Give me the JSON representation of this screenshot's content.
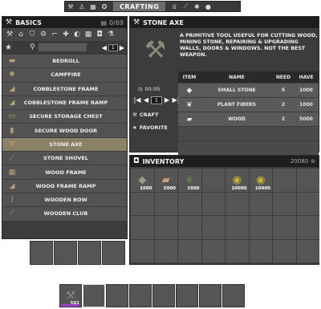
{
  "topbar": {
    "active_tab": "CRAFTING",
    "left_icons": [
      "hammer-icon",
      "person-icon",
      "map-icon",
      "skill-icon"
    ],
    "right_icons": [
      "trophy-icon",
      "sword-icon",
      "creatures-icon",
      "bulb-icon"
    ]
  },
  "basics": {
    "title": "BASICS",
    "count": "0/69",
    "categories": [
      "hammer-icon",
      "home-icon",
      "shield-icon",
      "wrench-icon",
      "gun-icon",
      "medkit-icon",
      "food-icon",
      "grid-icon"
    ],
    "search_placeholder": "",
    "page": "1",
    "recipes": [
      {
        "label": "BEDROLL",
        "icon": "▬"
      },
      {
        "label": "CAMPFIRE",
        "icon": "✺"
      },
      {
        "label": "COBBLESTONE FRAME",
        "icon": "◢"
      },
      {
        "label": "COBBLESTONE FRAME RAMP",
        "icon": "◢"
      },
      {
        "label": "SECURE STORAGE CHEST",
        "icon": "▭"
      },
      {
        "label": "SECURE WOOD DOOR",
        "icon": "▮"
      },
      {
        "label": "STONE AXE",
        "icon": "⚒",
        "selected": true
      },
      {
        "label": "STONE SHOVEL",
        "icon": "⟋"
      },
      {
        "label": "WOOD FRAME",
        "icon": "▦"
      },
      {
        "label": "WOOD FRAME RAMP",
        "icon": "◢"
      },
      {
        "label": "WOODEN BOW",
        "icon": ")"
      },
      {
        "label": "WOODEN CLUB",
        "icon": "⟋"
      }
    ]
  },
  "detail": {
    "title": "STONE AXE",
    "description": "A PRIMITIVE TOOL USEFUL FOR CUTTING WOOD, MINING STONE, REPAIRING & UPGRADING WALLS, DOORS & WINDOWS. NOT THE BEST WEAPON.",
    "craft_time": "00:05",
    "quantity": "1",
    "craft_label": "CRAFT",
    "favorite_label": "FAVORITE",
    "columns": {
      "item": "ITEM",
      "name": "NAME",
      "need": "NEED",
      "have": "HAVE"
    },
    "ingredients": [
      {
        "name": "SMALL STONE",
        "need": "5",
        "have": "1000",
        "icon": "◆"
      },
      {
        "name": "PLANT FIBERS",
        "need": "2",
        "have": "1000",
        "icon": "❦"
      },
      {
        "name": "WOOD",
        "need": "2",
        "have": "5000",
        "icon": "▰"
      }
    ]
  },
  "inventory": {
    "title": "INVENTORY",
    "currency": "20080",
    "slots": [
      {
        "icon": "◆",
        "count": "1000",
        "color": "#9a9a8a"
      },
      {
        "icon": "▰",
        "count": "5000",
        "color": "#c9a47a"
      },
      {
        "icon": "❦",
        "count": "1000",
        "color": "#5f7a48"
      },
      {
        "icon": "",
        "count": ""
      },
      {
        "icon": "◉",
        "count": "10000",
        "color": "#c8b030"
      },
      {
        "icon": "◉",
        "count": "10000",
        "color": "#c8b030"
      }
    ]
  },
  "toolbelt": {
    "slot1_count": "581",
    "slot1_icon": "⚒"
  }
}
